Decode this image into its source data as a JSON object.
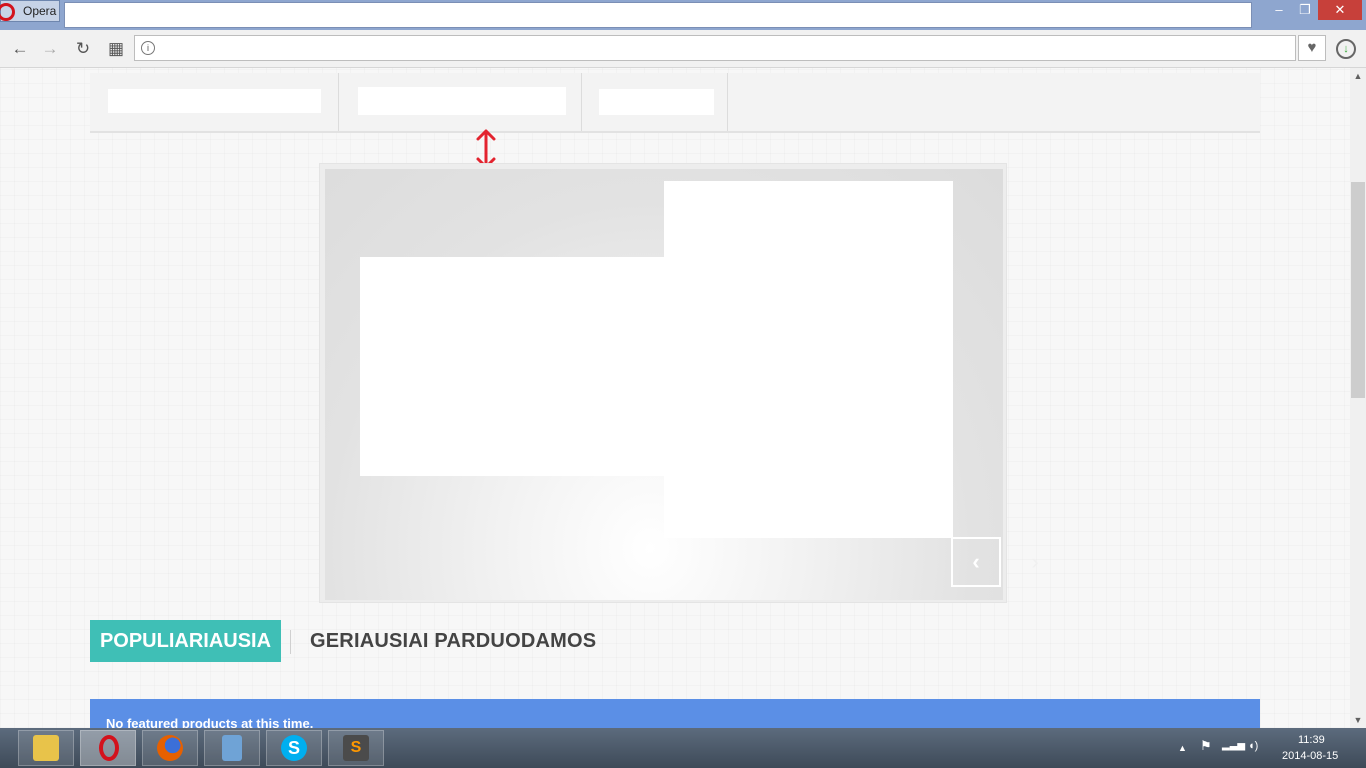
{
  "window": {
    "app_button_label": "Opera",
    "minimize_glyph": "–",
    "restore_glyph": "❐",
    "close_glyph": "✕"
  },
  "nav": {
    "back_glyph": "←",
    "forward_glyph": "→",
    "reload_glyph": "↻",
    "speed_dial_glyph": "▦",
    "site_info_glyph": "i",
    "address_value": "",
    "bookmark_glyph": "♥",
    "download_glyph": "↓"
  },
  "slider": {
    "prev_glyph": "‹",
    "next_glyph": "›"
  },
  "tabs": {
    "popular": "POPULIARIAUSIA",
    "bestsellers": "GERIAUSIAI PARDUODAMOS"
  },
  "notice": {
    "text": "No featured products at this time."
  },
  "scrollbar": {
    "up_glyph": "▲",
    "down_glyph": "▼"
  },
  "taskbar": {
    "apps": [
      {
        "name": "file-explorer-icon",
        "color": "#e8c34a"
      },
      {
        "name": "opera-icon",
        "color": "#d3121c"
      },
      {
        "name": "firefox-icon",
        "color": "#e66000"
      },
      {
        "name": "calculator-icon",
        "color": "#6fa3d6"
      },
      {
        "name": "skype-icon",
        "color": "#00aff0"
      },
      {
        "name": "sublime-text-icon",
        "color": "#4b4b4b"
      }
    ],
    "tray_glyphs": {
      "show_hidden": "▲",
      "flag": "⚑",
      "network": "▂▃▅",
      "volume": "◖)"
    },
    "time": "11:39",
    "date": "2014-08-15"
  },
  "colors": {
    "accent_teal": "#3fbfb6",
    "notice_blue": "#5b8fe6",
    "arrow_red": "#e3232f"
  }
}
